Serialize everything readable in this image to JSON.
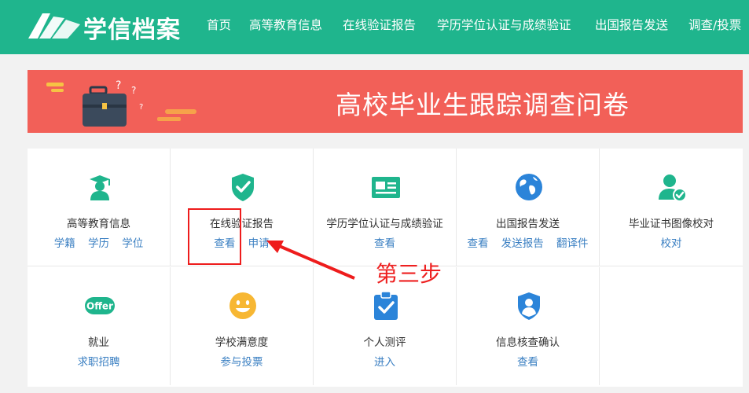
{
  "header": {
    "brand": "学信档案",
    "nav": [
      "首页",
      "高等教育信息",
      "在线验证报告",
      "学历学位认证与成绩验证",
      "出国报告发送",
      "调查/投票"
    ],
    "color": "#1fb58d"
  },
  "banner": {
    "title": "高校毕业生跟踪调查问卷",
    "color": "#f26058"
  },
  "services": [
    {
      "title": "高等教育信息",
      "links": [
        "学籍",
        "学历",
        "学位"
      ],
      "icon": "graduate-icon"
    },
    {
      "title": "在线验证报告",
      "links": [
        "查看",
        "申请"
      ],
      "icon": "shield-check-icon"
    },
    {
      "title": "学历学位认证与成绩验证",
      "links": [
        "查看"
      ],
      "icon": "id-card-icon"
    },
    {
      "title": "出国报告发送",
      "links": [
        "查看",
        "发送报告",
        "翻译件"
      ],
      "icon": "globe-icon"
    },
    {
      "title": "毕业证书图像校对",
      "links": [
        "校对"
      ],
      "icon": "user-check-icon"
    },
    {
      "title": "就业",
      "links": [
        "求职招聘"
      ],
      "icon": "offer-icon"
    },
    {
      "title": "学校满意度",
      "links": [
        "参与投票"
      ],
      "icon": "smiley-icon"
    },
    {
      "title": "个人测评",
      "links": [
        "进入"
      ],
      "icon": "clipboard-check-icon"
    },
    {
      "title": "信息核查确认",
      "links": [
        "查看"
      ],
      "icon": "shield-user-icon"
    }
  ],
  "annotation": {
    "step_label": "第三步",
    "color": "#ee1c1c"
  }
}
